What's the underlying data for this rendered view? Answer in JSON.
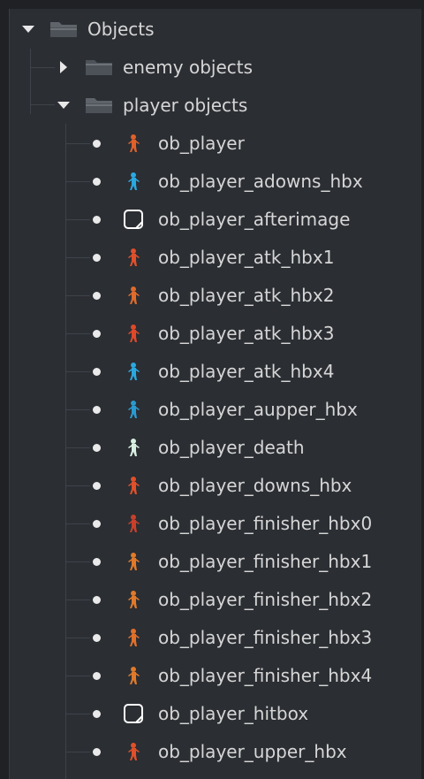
{
  "tree": {
    "root": {
      "label": "Objects",
      "icon": "folder-open-icon"
    },
    "groups": [
      {
        "label": "enemy objects",
        "expanded": false,
        "icon": "folder-closed-icon"
      },
      {
        "label": "player objects",
        "expanded": true,
        "icon": "folder-open-icon"
      }
    ],
    "items": [
      {
        "label": "ob_player",
        "icon": "player-sprite-icon",
        "color": "#e0602a"
      },
      {
        "label": "ob_player_adowns_hbx",
        "icon": "player-sprite-icon",
        "color": "#2aa8e0"
      },
      {
        "label": "ob_player_afterimage",
        "icon": "empty-sprite-icon",
        "color": "#ffffff"
      },
      {
        "label": "ob_player_atk_hbx1",
        "icon": "player-sprite-icon",
        "color": "#e0502a"
      },
      {
        "label": "ob_player_atk_hbx2",
        "icon": "player-sprite-icon",
        "color": "#e06a2a"
      },
      {
        "label": "ob_player_atk_hbx3",
        "icon": "player-sprite-icon",
        "color": "#e0482a"
      },
      {
        "label": "ob_player_atk_hbx4",
        "icon": "player-sprite-icon",
        "color": "#2aa8e0"
      },
      {
        "label": "ob_player_aupper_hbx",
        "icon": "player-sprite-icon",
        "color": "#2a9ad0"
      },
      {
        "label": "ob_player_death",
        "icon": "player-sprite-icon",
        "color": "#d8efe0"
      },
      {
        "label": "ob_player_downs_hbx",
        "icon": "player-sprite-icon",
        "color": "#e0502a"
      },
      {
        "label": "ob_player_finisher_hbx0",
        "icon": "player-sprite-icon",
        "color": "#c8402a"
      },
      {
        "label": "ob_player_finisher_hbx1",
        "icon": "player-sprite-icon",
        "color": "#e07a2a"
      },
      {
        "label": "ob_player_finisher_hbx2",
        "icon": "player-sprite-icon",
        "color": "#e07a2a"
      },
      {
        "label": "ob_player_finisher_hbx3",
        "icon": "player-sprite-icon",
        "color": "#e0702a"
      },
      {
        "label": "ob_player_finisher_hbx4",
        "icon": "player-sprite-icon",
        "color": "#e07a2a"
      },
      {
        "label": "ob_player_hitbox",
        "icon": "empty-sprite-icon",
        "color": "#ffffff"
      },
      {
        "label": "ob_player_upper_hbx",
        "icon": "player-sprite-icon",
        "color": "#e0502a"
      }
    ]
  }
}
